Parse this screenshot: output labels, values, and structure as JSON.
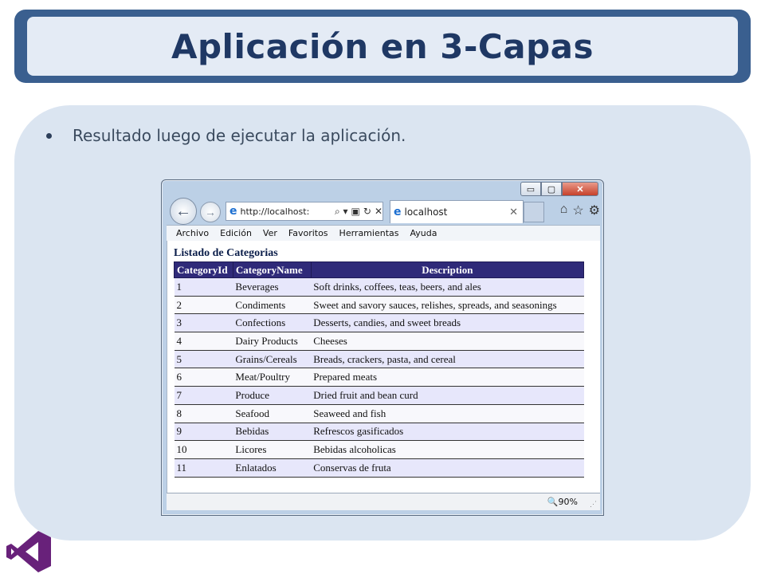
{
  "slide": {
    "title": "Aplicación en 3-Capas",
    "bullet": "Resultado luego de ejecutar la aplicación."
  },
  "browser": {
    "window_controls": {
      "minimize": "▭",
      "maximize": "▢",
      "close": "✕"
    },
    "address_url": "http://localhost:",
    "address_tools": [
      "⌕ ▾",
      "▣",
      "↻",
      "✕"
    ],
    "tab_title": "localhost",
    "tab_close": "✕",
    "right_icons": [
      "⌂",
      "☆",
      "⚙"
    ],
    "menu": [
      "Archivo",
      "Edición",
      "Ver",
      "Favoritos",
      "Herramientas",
      "Ayuda"
    ],
    "zoom": "🔍90%",
    "zoom_caret": "▼"
  },
  "listing": {
    "title": "Listado de Categorias",
    "headers": [
      "CategoryId",
      "CategoryName",
      "Description"
    ],
    "rows": [
      [
        "1",
        "Beverages",
        "Soft drinks, coffees, teas, beers, and ales"
      ],
      [
        "2",
        "Condiments",
        "Sweet and savory sauces, relishes, spreads, and seasonings"
      ],
      [
        "3",
        "Confections",
        "Desserts, candies, and sweet breads"
      ],
      [
        "4",
        "Dairy Products",
        "Cheeses"
      ],
      [
        "5",
        "Grains/Cereals",
        "Breads, crackers, pasta, and cereal"
      ],
      [
        "6",
        "Meat/Poultry",
        "Prepared meats"
      ],
      [
        "7",
        "Produce",
        "Dried fruit and bean curd"
      ],
      [
        "8",
        "Seafood",
        "Seaweed and fish"
      ],
      [
        "9",
        "Bebidas",
        "Refrescos gasificados"
      ],
      [
        "10",
        "Licores",
        "Bebidas alcoholicas"
      ],
      [
        "11",
        "Enlatados",
        "Conservas de fruta"
      ]
    ]
  },
  "colors": {
    "banner": "#3a5f8f",
    "title": "#1f3864",
    "panel": "#dbe5f1",
    "grid_header": "#2f2a79",
    "row_alt": "#e7e7fb",
    "logo": "#68217a"
  }
}
